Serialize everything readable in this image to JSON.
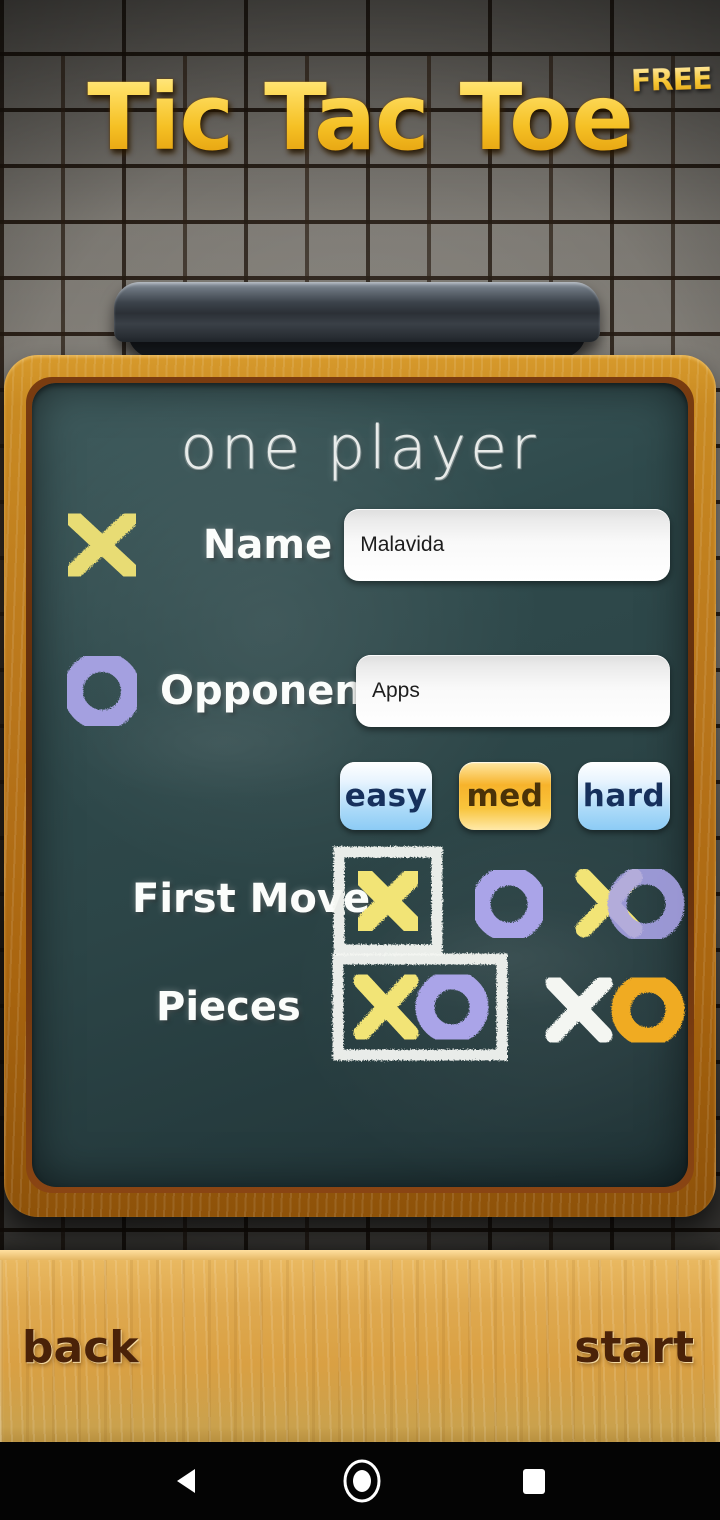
{
  "app": {
    "title": "Tic Tac Toe",
    "badge": "FREE"
  },
  "board": {
    "heading": "one player",
    "name_row": {
      "icon": "chalk-x-icon",
      "label": "Name",
      "value": "Malavida",
      "placeholder": "Name"
    },
    "opponent_row": {
      "icon": "chalk-o-icon",
      "label": "Opponent",
      "value": "Apps",
      "placeholder": "Opponent"
    },
    "difficulty": {
      "selected": "med",
      "options": [
        {
          "id": "easy",
          "label": "easy",
          "selected": false
        },
        {
          "id": "med",
          "label": "med",
          "selected": true
        },
        {
          "id": "hard",
          "label": "hard",
          "selected": false
        }
      ]
    },
    "first_move": {
      "label": "First Move",
      "selected": "x",
      "options": [
        {
          "id": "x",
          "icon": "chalk-x-icon",
          "selected": true
        },
        {
          "id": "o",
          "icon": "chalk-o-icon",
          "selected": false
        },
        {
          "id": "random",
          "icon": "chalk-xo-random-icon",
          "selected": false
        }
      ]
    },
    "pieces": {
      "label": "Pieces",
      "selected": "yellow-purple",
      "options": [
        {
          "id": "yellow-purple",
          "icon": "chalk-xo-yellow-purple-icon",
          "selected": true
        },
        {
          "id": "white-orange",
          "icon": "chalk-xo-white-orange-icon",
          "selected": false
        }
      ]
    }
  },
  "shelf": {
    "back_label": "back",
    "start_label": "start"
  },
  "navbar": {
    "back": "nav-back-icon",
    "home": "nav-home-icon",
    "recents": "nav-recents-icon"
  },
  "colors": {
    "chalk_yellow": "#f2e476",
    "chalk_purple": "#aaa4e8",
    "chalk_white": "#f4f6f2",
    "chalk_orange": "#f0ab20",
    "board_green": "#2c4547",
    "frame_wood": "#b9761b",
    "shelf_wood": "#dfa94f",
    "title_gold": "#f5c024",
    "diff_selected": "#f7b32b",
    "diff_unselected": "#a9d9f8"
  }
}
